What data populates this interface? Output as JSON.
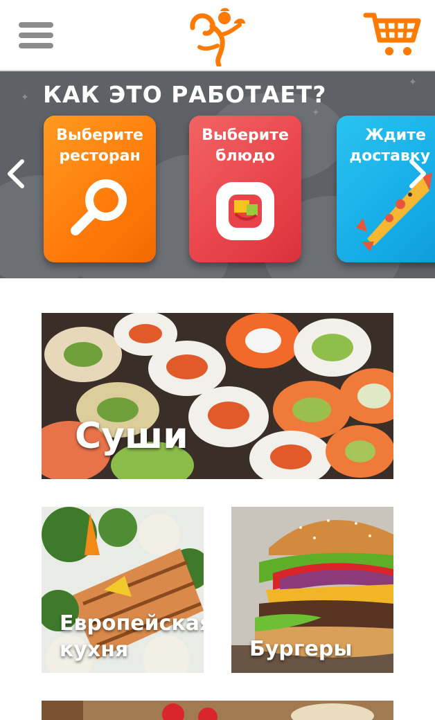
{
  "header": {
    "menu_icon": "hamburger-menu-icon",
    "logo_icon": "chef-running-logo",
    "cart_icon": "shopping-cart-icon",
    "brand_color": "#ff7a00",
    "menu_color": "#8c8c8c"
  },
  "banner": {
    "title": "КАК ЭТО РАБОТАЕТ?",
    "steps": [
      {
        "label": "Выберите\nресторан",
        "icon": "magnifier-icon",
        "color": "#ff8a14"
      },
      {
        "label": "Выберите\nблюдо",
        "icon": "food-plate-icon",
        "color": "#ea4a4f"
      },
      {
        "label": "Ждите\nдоставку :",
        "icon": "pizza-rocket-icon",
        "color": "#1aaee8"
      }
    ],
    "prev_icon": "chevron-left-icon",
    "next_icon": "chevron-right-icon"
  },
  "categories": [
    {
      "label": "Суши"
    },
    {
      "label": "Европейская\nкухня"
    },
    {
      "label": "Бургеры"
    }
  ]
}
